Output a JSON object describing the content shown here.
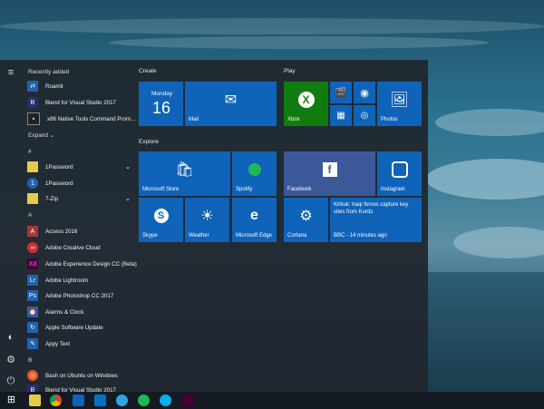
{
  "start": {
    "recently_added_label": "Recently added",
    "recent": [
      "Roamit",
      "Blend for Visual Studio 2017",
      "x86 Native Tools Command Prom..."
    ],
    "expand_label": "Expand",
    "hash_label": "#",
    "hash_apps": [
      "1Password",
      "1Password",
      "7-Zip"
    ],
    "a_label": "A",
    "a_apps": [
      "Access 2016",
      "Adobe Creative Cloud",
      "Adobe Experience Design CC (Beta)",
      "Adobe Lightroom",
      "Adobe Photoshop CC 2017",
      "Alarms & Clock",
      "Apple Software Update",
      "Appy Text"
    ],
    "b_label": "B",
    "b_apps": [
      "Bash on Ubuntu on Windows",
      "Blend for Visual Studio 2017"
    ]
  },
  "groups": {
    "create": "Create",
    "play": "Play",
    "explore": "Explore"
  },
  "tiles": {
    "calendar_day": "Monday",
    "calendar_date": "16",
    "mail": "Mail",
    "xbox": "Xbox",
    "photos": "Photos",
    "microsoft_store": "Microsoft Store",
    "spotify": "Spotify",
    "facebook": "Facebook",
    "instagram": "Instagram",
    "skype": "Skype",
    "weather": "Weather",
    "microsoft_edge": "Microsoft Edge",
    "cortana": "Cortana",
    "cortana_news": "Kirkuk: Iraqi forces capture key sites from Kurds",
    "cortana_meta": "BBC - 14 minutes ago"
  },
  "colors": {
    "tile_blue": "#0f63b8",
    "xbox_green": "#107c10",
    "facebook_blue": "#3b5998"
  }
}
